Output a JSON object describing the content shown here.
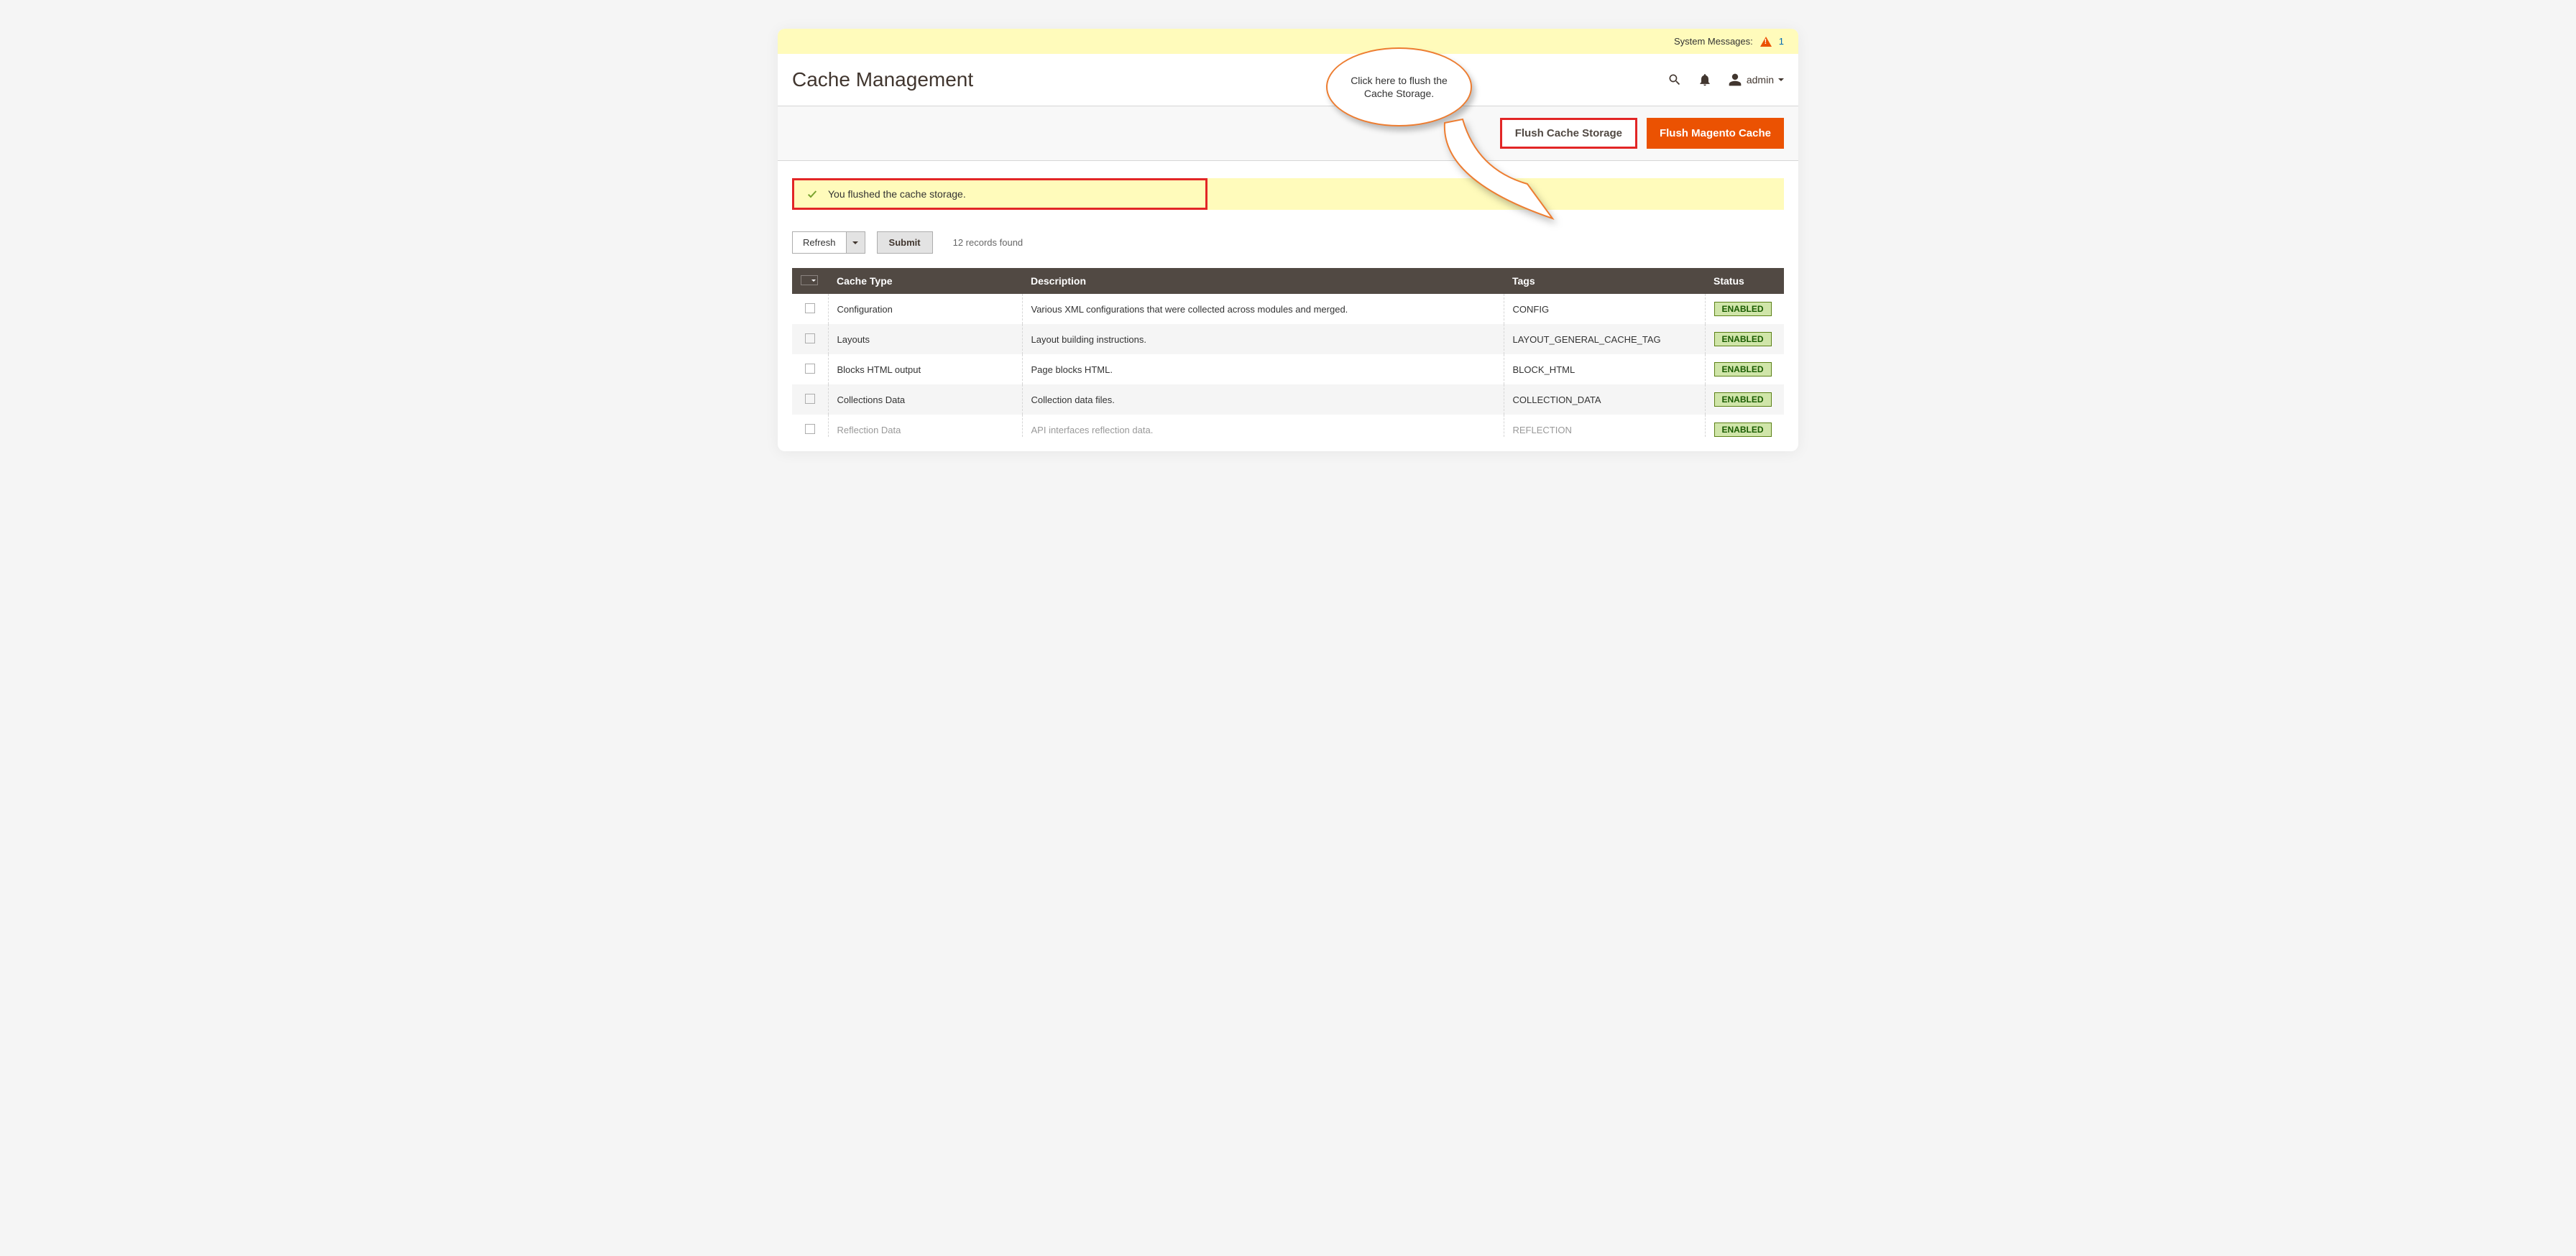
{
  "system_messages": {
    "label": "System Messages:",
    "count": "1"
  },
  "page_title": "Cache Management",
  "admin_user": "admin",
  "callout_text": "Click here to flush the Cache Storage.",
  "buttons": {
    "flush_storage": "Flush Cache Storage",
    "flush_magento": "Flush Magento Cache"
  },
  "success_message": "You flushed the cache storage.",
  "toolbar": {
    "action_select": "Refresh",
    "submit": "Submit",
    "records_found": "12 records found"
  },
  "columns": {
    "cache_type": "Cache Type",
    "description": "Description",
    "tags": "Tags",
    "status": "Status"
  },
  "rows": [
    {
      "type": "Configuration",
      "desc": "Various XML configurations that were collected across modules and merged.",
      "tags": "CONFIG",
      "status": "ENABLED"
    },
    {
      "type": "Layouts",
      "desc": "Layout building instructions.",
      "tags": "LAYOUT_GENERAL_CACHE_TAG",
      "status": "ENABLED"
    },
    {
      "type": "Blocks HTML output",
      "desc": "Page blocks HTML.",
      "tags": "BLOCK_HTML",
      "status": "ENABLED"
    },
    {
      "type": "Collections Data",
      "desc": "Collection data files.",
      "tags": "COLLECTION_DATA",
      "status": "ENABLED"
    },
    {
      "type": "Reflection Data",
      "desc": "API interfaces reflection data.",
      "tags": "REFLECTION",
      "status": "ENABLED"
    }
  ]
}
